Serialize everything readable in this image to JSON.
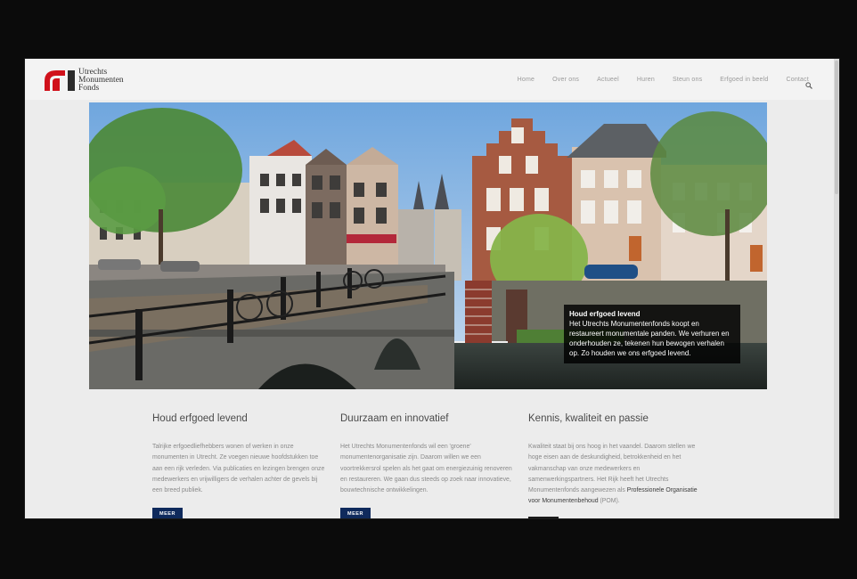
{
  "brand": {
    "line1": "Utrechts",
    "line2": "Monumenten",
    "line3": "Fonds",
    "accent_color": "#d0111b"
  },
  "nav": {
    "items": [
      "Home",
      "Over ons",
      "Actueel",
      "Huren",
      "Steun ons",
      "Erfgoed in beeld",
      "Contact"
    ],
    "search_icon": "search-icon"
  },
  "hero": {
    "caption_title": "Houd erfgoed levend",
    "caption_text": "Het Utrechts Monumentenfonds koopt en restaureert monumentale panden. We verhuren en onderhouden ze, tekenen hun bewogen verhalen op. Zo houden we ons erfgoed levend.",
    "slider_prev_icon": "chevron-right-icon",
    "slider_pause_icon": "pause-icon"
  },
  "columns": [
    {
      "title": "Houd erfgoed levend",
      "text": "Talrijke erfgoedliefhebbers wonen of werken in onze monumenten in Utrecht. Ze voegen nieuwe hoofdstukken toe aan een rijk verleden. Via publicaties en lezingen brengen onze medewerkers en vrijwilligers de verhalen achter de gevels bij een breed publiek.",
      "button": "MEER"
    },
    {
      "title": "Duurzaam en innovatief",
      "text": "Het Utrechts Monumentenfonds wil een 'groene' monumentenorganisatie zijn. Daarom willen we een voortrekkersrol spelen als het gaat om energiezuinig renoveren en restaureren. We gaan dus steeds op zoek naar innovatieve, bouwtechnische ontwikkelingen.",
      "button": "MEER"
    },
    {
      "title": "Kennis, kwaliteit en passie",
      "text": "Kwaliteit staat bij ons hoog in het vaandel. Daarom stellen we hoge eisen aan de deskundigheid, betrokkenheid en het vakmanschap van onze medewerkers en samenwerkingspartners. Het Rijk heeft het Utrechts Monumentenfonds aangewezen als",
      "text_strong": "Professionele Organisatie voor Monumentenbehoud",
      "text_end": " (POM)."
    }
  ]
}
